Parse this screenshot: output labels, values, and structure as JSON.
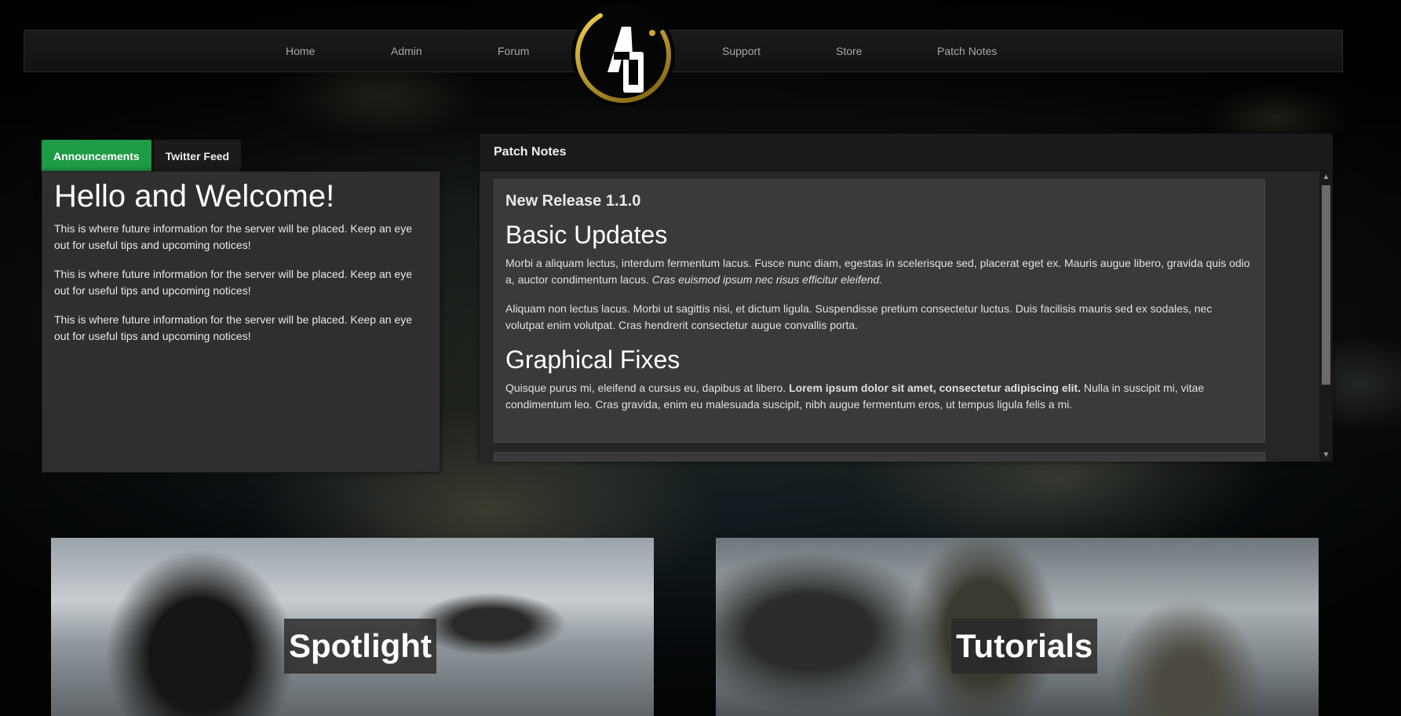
{
  "nav": {
    "items": [
      "Home",
      "Admin",
      "Forum",
      "Support",
      "Store",
      "Patch Notes"
    ],
    "logo_text": "AO"
  },
  "tabs": {
    "announcements": "Announcements",
    "twitter": "Twitter Feed"
  },
  "announcements": {
    "title": "Hello and Welcome!",
    "paragraphs": [
      "This is where future information for the server will be placed. Keep an eye out for useful tips and upcoming notices!",
      "This is where future information for the server will be placed. Keep an eye out for useful tips and upcoming notices!",
      "This is where future information for the server will be placed. Keep an eye out for useful tips and upcoming notices!"
    ]
  },
  "patch_notes": {
    "header": "Patch Notes",
    "release_title": "New Release 1.1.0",
    "section1_title": "Basic Updates",
    "p1_text": "Morbi a aliquam lectus, interdum fermentum lacus. Fusce nunc diam, egestas in scelerisque sed, placerat eget ex. Mauris augue libero, gravida quis odio a, auctor condimentum lacus. ",
    "p1_italic": "Cras euismod ipsum nec risus efficitur eleifend.",
    "p2_text": "Aliquam non lectus lacus. Morbi ut sagittis nisi, et dictum ligula. Suspendisse pretium consectetur luctus. Duis facilisis mauris sed ex sodales, nec volutpat enim volutpat. Cras hendrerit consectetur augue convallis porta.",
    "section2_title": "Graphical Fixes",
    "p3_before": "Quisque purus mi, eleifend a cursus eu, dapibus at libero. ",
    "p3_bold": "Lorem ipsum dolor sit amet, consectetur adipiscing elit.",
    "p3_after": " Nulla in suscipit mi, vitae condimentum leo. Cras gravida, enim eu malesuada suscipit, nibh augue fermentum eros, ut tempus ligula felis a mi."
  },
  "cards": {
    "spotlight": "Spotlight",
    "tutorials": "Tutorials"
  },
  "colors": {
    "accent_green": "#1e9b45",
    "logo_gold": "#c9a52a"
  }
}
